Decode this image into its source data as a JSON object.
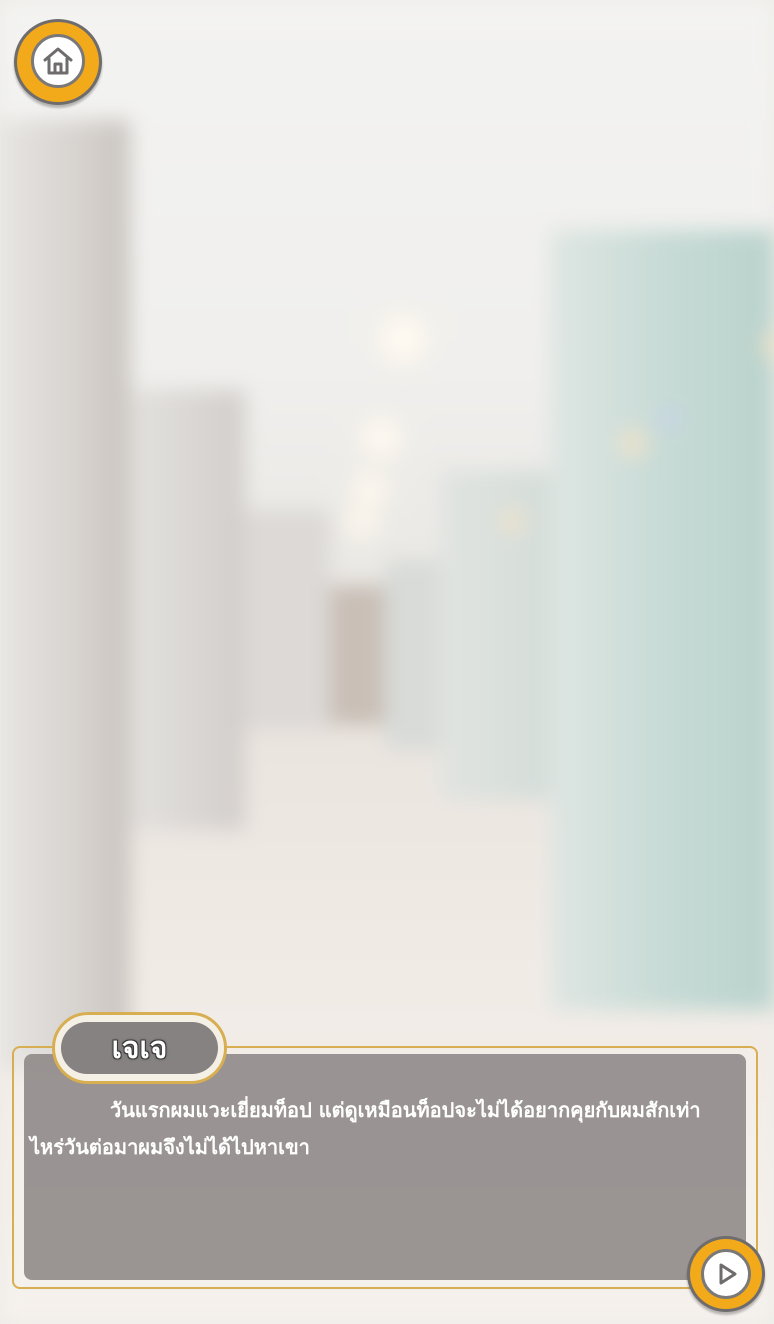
{
  "scene": {
    "background": "blurred-office-hallway"
  },
  "controls": {
    "home_icon": "home-icon",
    "next_icon": "play-triangle-icon"
  },
  "dialogue": {
    "speaker": "เจเจ",
    "text": "วันแรกผมแวะเยี่ยมท็อป แต่ดูเหมือนท็อปจะไม่ได้อยากคุยกับผมสักเท่าไหร่วันต่อมาผมจึงไม่ได้ไปหาเขา"
  },
  "colors": {
    "accent": "#f2a91a",
    "frame": "#d8ae52",
    "panel": "#8d8686",
    "text": "#ffffff"
  }
}
